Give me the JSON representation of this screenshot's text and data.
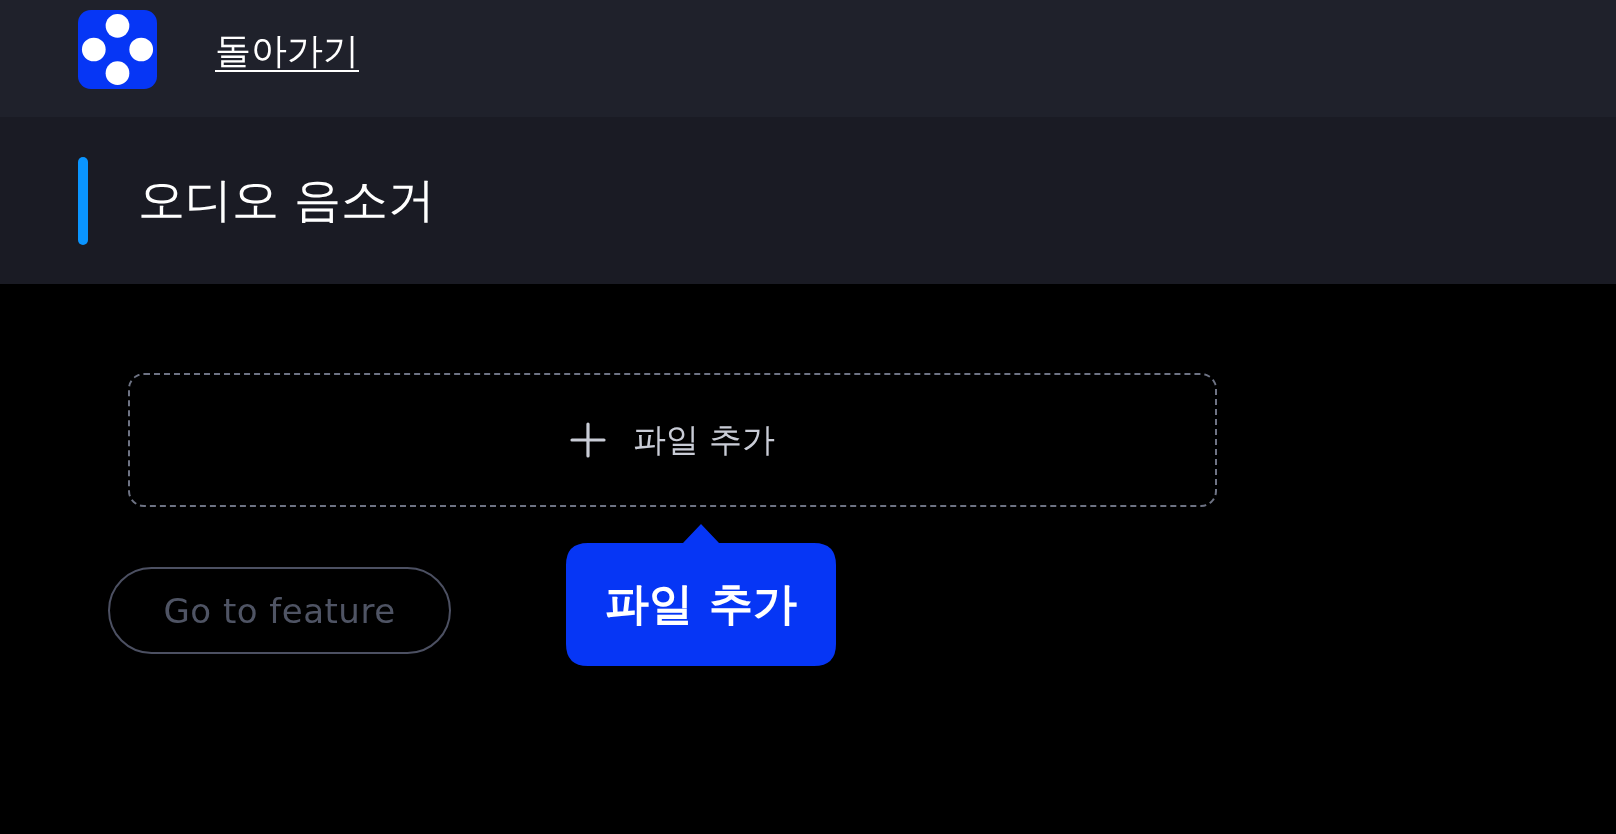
{
  "header": {
    "back_link": "돌아가기"
  },
  "page_title": "오디오 음소거",
  "dropzone": {
    "label": "파일 추가"
  },
  "feature_button": {
    "label": "Go to feature",
    "disabled": true
  },
  "tooltip": {
    "text": "파일 추가"
  }
}
